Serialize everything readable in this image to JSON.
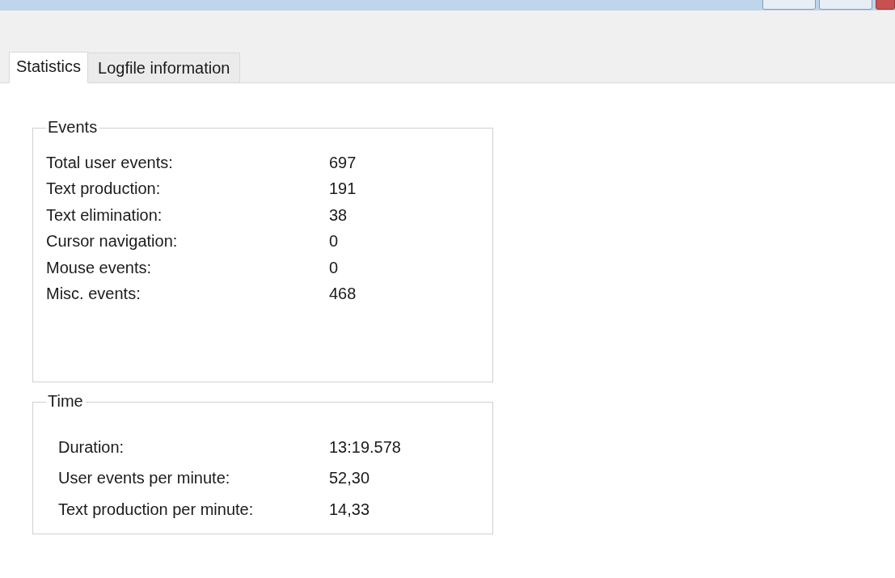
{
  "tabs": [
    {
      "label": "Statistics",
      "selected": true
    },
    {
      "label": "Logfile information",
      "selected": false
    }
  ],
  "groups": [
    {
      "title": "Events",
      "rows": [
        {
          "label": "Total user events:",
          "value": "697"
        },
        {
          "label": "Text production:",
          "value": "191"
        },
        {
          "label": "Text elimination:",
          "value": "38"
        },
        {
          "label": "Cursor navigation:",
          "value": "0"
        },
        {
          "label": "Mouse events:",
          "value": "0"
        },
        {
          "label": "Misc. events:",
          "value": "468"
        }
      ]
    },
    {
      "title": "Time",
      "rows": [
        {
          "label": "Duration:",
          "value": "13:19.578"
        },
        {
          "label": "User events per minute:",
          "value": "52,30"
        },
        {
          "label": "Text production per minute:",
          "value": "14,33"
        }
      ]
    }
  ]
}
